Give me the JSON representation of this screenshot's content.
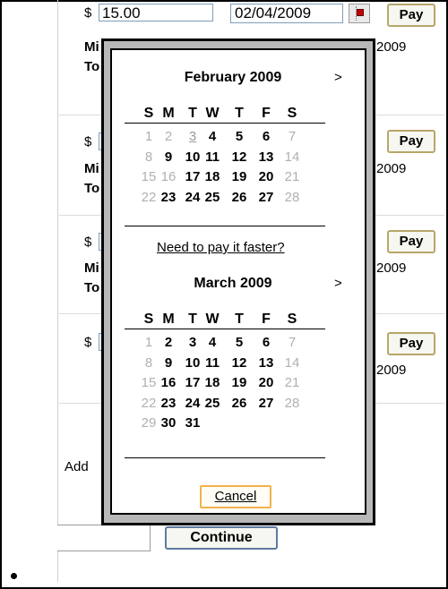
{
  "rows": [
    {
      "currency": "$",
      "amount": "15.00",
      "date": "02/04/2009",
      "pay_label": "Pay",
      "line1": "Mi",
      "line2": "To",
      "date_suffix": "2009"
    },
    {
      "currency": "$",
      "pay_label": "Pay",
      "line1": "Mi",
      "line2": "To",
      "date_suffix": "2009"
    },
    {
      "currency": "$",
      "pay_label": "Pay",
      "line1": "Mi",
      "line2": "To",
      "date_suffix": "2009"
    },
    {
      "currency": "$",
      "pay_label": "Pay",
      "date_suffix": "2009"
    }
  ],
  "add_label": "Add",
  "continue_label": "Continue",
  "calendar": {
    "weekdays": [
      "S",
      "M",
      "T",
      "W",
      "T",
      "F",
      "S"
    ],
    "next_arrow": ">",
    "months": [
      {
        "title": "February 2009",
        "weeks": [
          [
            {
              "d": "1",
              "s": "unavail"
            },
            {
              "d": "2",
              "s": "unavail"
            },
            {
              "d": "3",
              "s": "today"
            },
            {
              "d": "4",
              "s": "avail"
            },
            {
              "d": "5",
              "s": "avail"
            },
            {
              "d": "6",
              "s": "avail"
            },
            {
              "d": "7",
              "s": "unavail"
            }
          ],
          [
            {
              "d": "8",
              "s": "unavail"
            },
            {
              "d": "9",
              "s": "avail"
            },
            {
              "d": "10",
              "s": "avail"
            },
            {
              "d": "11",
              "s": "avail"
            },
            {
              "d": "12",
              "s": "avail"
            },
            {
              "d": "13",
              "s": "avail"
            },
            {
              "d": "14",
              "s": "unavail"
            }
          ],
          [
            {
              "d": "15",
              "s": "unavail"
            },
            {
              "d": "16",
              "s": "unavail"
            },
            {
              "d": "17",
              "s": "avail"
            },
            {
              "d": "18",
              "s": "avail"
            },
            {
              "d": "19",
              "s": "avail"
            },
            {
              "d": "20",
              "s": "avail"
            },
            {
              "d": "21",
              "s": "unavail"
            }
          ],
          [
            {
              "d": "22",
              "s": "unavail"
            },
            {
              "d": "23",
              "s": "avail"
            },
            {
              "d": "24",
              "s": "avail"
            },
            {
              "d": "25",
              "s": "avail"
            },
            {
              "d": "26",
              "s": "avail"
            },
            {
              "d": "27",
              "s": "avail"
            },
            {
              "d": "28",
              "s": "unavail"
            }
          ]
        ]
      },
      {
        "title": "March 2009",
        "weeks": [
          [
            {
              "d": "1",
              "s": "unavail"
            },
            {
              "d": "2",
              "s": "avail"
            },
            {
              "d": "3",
              "s": "avail"
            },
            {
              "d": "4",
              "s": "avail"
            },
            {
              "d": "5",
              "s": "avail"
            },
            {
              "d": "6",
              "s": "avail"
            },
            {
              "d": "7",
              "s": "unavail"
            }
          ],
          [
            {
              "d": "8",
              "s": "unavail"
            },
            {
              "d": "9",
              "s": "avail"
            },
            {
              "d": "10",
              "s": "avail"
            },
            {
              "d": "11",
              "s": "avail"
            },
            {
              "d": "12",
              "s": "avail"
            },
            {
              "d": "13",
              "s": "avail"
            },
            {
              "d": "14",
              "s": "unavail"
            }
          ],
          [
            {
              "d": "15",
              "s": "unavail"
            },
            {
              "d": "16",
              "s": "avail"
            },
            {
              "d": "17",
              "s": "avail"
            },
            {
              "d": "18",
              "s": "avail"
            },
            {
              "d": "19",
              "s": "avail"
            },
            {
              "d": "20",
              "s": "avail"
            },
            {
              "d": "21",
              "s": "unavail"
            }
          ],
          [
            {
              "d": "22",
              "s": "unavail"
            },
            {
              "d": "23",
              "s": "avail"
            },
            {
              "d": "24",
              "s": "avail"
            },
            {
              "d": "25",
              "s": "avail"
            },
            {
              "d": "26",
              "s": "avail"
            },
            {
              "d": "27",
              "s": "avail"
            },
            {
              "d": "28",
              "s": "unavail"
            }
          ],
          [
            {
              "d": "29",
              "s": "unavail"
            },
            {
              "d": "30",
              "s": "avail"
            },
            {
              "d": "31",
              "s": "avail"
            }
          ]
        ]
      }
    ],
    "faster_link": "Need to pay it faster?",
    "cancel_label": "Cancel"
  },
  "colors": {
    "unavailable_day": "#b0b0b0",
    "popup_frame": "#b8b8b8",
    "pay_border": "#b7a66a",
    "cancel_border": "#f2b24b"
  }
}
